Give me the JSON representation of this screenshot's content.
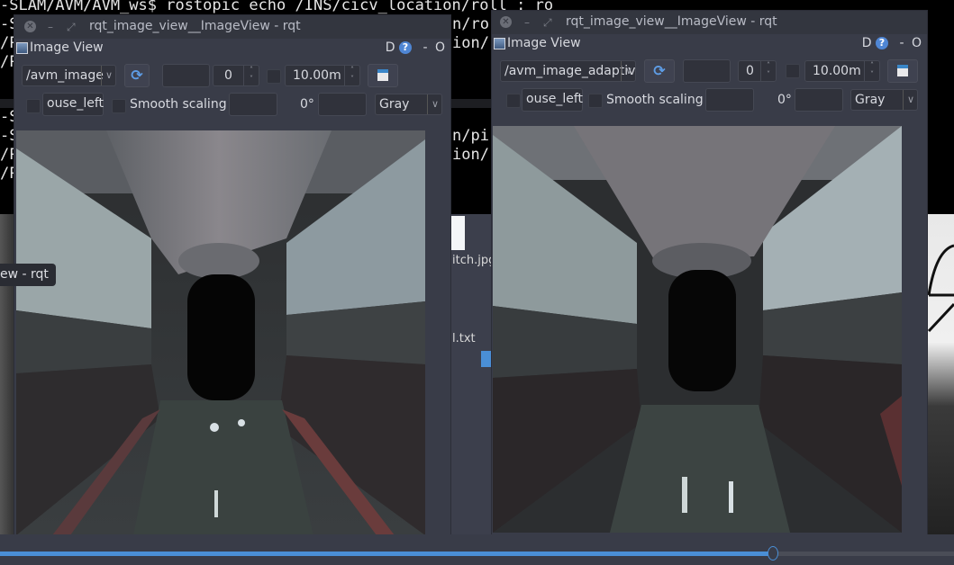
{
  "terminal": {
    "lines_top": [
      "-SLAM/AVM/AVM_ws$ rostopic echo /INS/cicv_location/roll : ro",
      "-S",
      "/P",
      "/P"
    ],
    "lines_top_right": [
      "n/ro",
      "ion/"
    ],
    "lines_mid_left": [
      "-S",
      "-S",
      "/P",
      "/P"
    ],
    "lines_mid_right": [
      "n/pi",
      "ion/"
    ]
  },
  "file_panel": {
    "items": [
      "itch.jpg",
      "l.txt"
    ]
  },
  "tooltip": {
    "text": "ew - rqt"
  },
  "windows": [
    {
      "title": "rqt_image_view__ImageView - rqt",
      "dock_title": "Image View",
      "dock_right": {
        "d_label": "D",
        "help": "?",
        "minimize": "-",
        "close": "O"
      },
      "topic": "/avm_image",
      "spin_value": "0",
      "time_value": "10.00m",
      "mouse_topic": "ouse_left",
      "smooth_label": "Smooth scaling",
      "rotation": "0°",
      "colormap": "Gray"
    },
    {
      "title": "rqt_image_view__ImageView - rqt",
      "dock_title": "Image View",
      "dock_right": {
        "d_label": "D",
        "help": "?",
        "minimize": "-",
        "close": "O"
      },
      "topic": "/avm_image_adaptiv",
      "spin_value": "0",
      "time_value": "10.00m",
      "mouse_topic": "ouse_left",
      "smooth_label": "Smooth scaling",
      "rotation": "0°",
      "colormap": "Gray"
    }
  ],
  "playback": {
    "progress_percent": 81
  },
  "colors": {
    "accent": "#4a8fd6",
    "window_bg": "#393c48",
    "titlebar_bg": "#33363f"
  }
}
